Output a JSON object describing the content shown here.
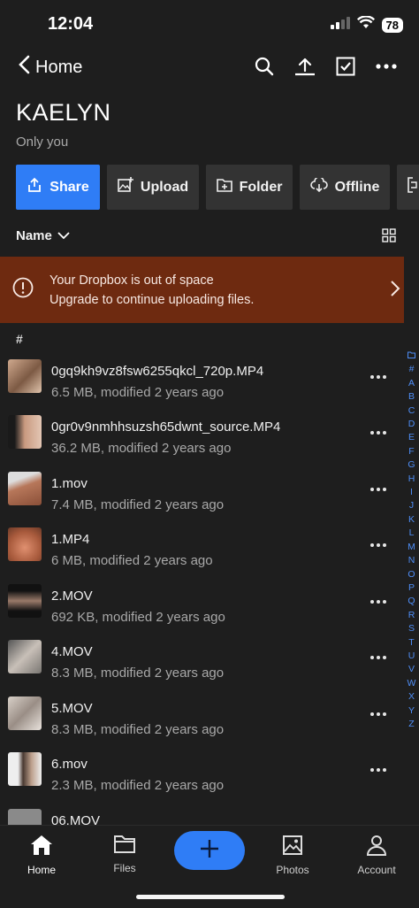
{
  "status": {
    "time": "12:04",
    "battery": "78"
  },
  "nav": {
    "back_label": "Home"
  },
  "folder": {
    "title": "KAELYN",
    "subtitle": "Only you"
  },
  "actions": [
    "Share",
    "Upload",
    "Folder",
    "Offline"
  ],
  "sort": {
    "label": "Name"
  },
  "banner": {
    "line1": "Your Dropbox is out of space",
    "line2": "Upgrade to continue uploading files."
  },
  "section_label": "#",
  "files": [
    {
      "name": "0gq9kh9vz8fsw6255qkcl_720p.MP4",
      "meta": "6.5 MB, modified 2 years ago"
    },
    {
      "name": "0gr0v9nmhhsuzsh65dwnt_source.MP4",
      "meta": "36.2 MB, modified 2 years ago"
    },
    {
      "name": "1.mov",
      "meta": "7.4 MB, modified 2 years ago"
    },
    {
      "name": "1.MP4",
      "meta": "6 MB, modified 2 years ago"
    },
    {
      "name": "2.MOV",
      "meta": "692 KB, modified 2 years ago"
    },
    {
      "name": "4.MOV",
      "meta": "8.3 MB, modified 2 years ago"
    },
    {
      "name": "5.MOV",
      "meta": "8.3 MB, modified 2 years ago"
    },
    {
      "name": "6.mov",
      "meta": "2.3 MB, modified 2 years ago"
    },
    {
      "name": "06.MOV",
      "meta": ""
    }
  ],
  "alpha_index": [
    "#",
    "A",
    "B",
    "C",
    "D",
    "E",
    "F",
    "G",
    "H",
    "I",
    "J",
    "K",
    "L",
    "M",
    "N",
    "O",
    "P",
    "Q",
    "R",
    "S",
    "T",
    "U",
    "V",
    "W",
    "X",
    "Y",
    "Z"
  ],
  "tabs": {
    "home": "Home",
    "files": "Files",
    "photos": "Photos",
    "account": "Account"
  },
  "colors": {
    "accent": "#2f7df6",
    "banner": "#6e2a10",
    "background": "#1e1e1e"
  }
}
